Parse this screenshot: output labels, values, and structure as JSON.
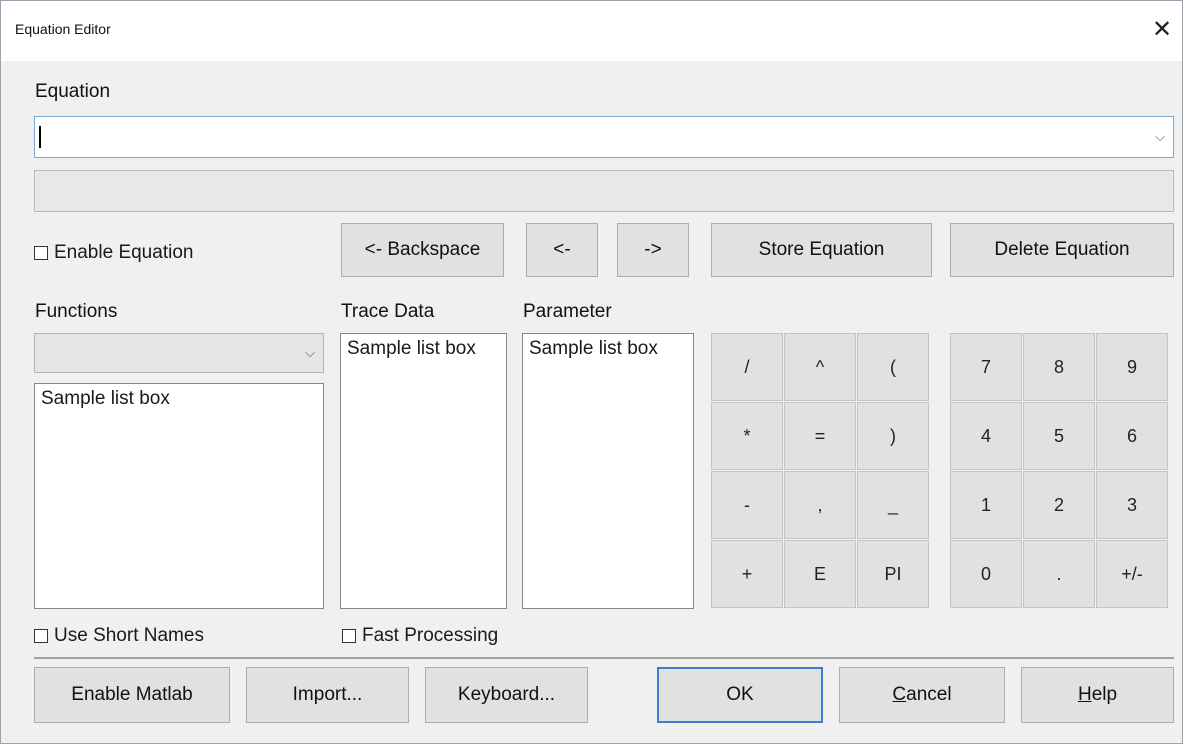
{
  "window": {
    "title": "Equation Editor",
    "close_glyph": "✕"
  },
  "equation": {
    "label": "Equation",
    "value": "",
    "dropdown_icon": "chevron-down-icon"
  },
  "controls": {
    "enable_equation": "Enable Equation",
    "backspace": "<- Backspace",
    "left": "<-",
    "right": "->",
    "store": "Store Equation",
    "delete": "Delete Equation"
  },
  "functions": {
    "label": "Functions",
    "selected": "",
    "list_item": "Sample list box"
  },
  "trace_data": {
    "label": "Trace Data",
    "list_item": "Sample list box"
  },
  "parameter": {
    "label": "Parameter",
    "list_item": "Sample list box"
  },
  "keypad_ops": [
    [
      "/",
      "^",
      "("
    ],
    [
      "*",
      "=",
      ")"
    ],
    [
      "-",
      ",",
      "_"
    ],
    [
      "+",
      "E",
      "PI"
    ]
  ],
  "keypad_nums": [
    [
      "7",
      "8",
      "9"
    ],
    [
      "4",
      "5",
      "6"
    ],
    [
      "1",
      "2",
      "3"
    ],
    [
      "0",
      ".",
      "+/-"
    ]
  ],
  "options": {
    "short_names": "Use Short Names",
    "fast_processing": "Fast Processing"
  },
  "footer": {
    "enable_matlab": "Enable Matlab",
    "import": "Import...",
    "keyboard": "Keyboard...",
    "ok": "OK",
    "cancel_prefix": "C",
    "cancel_rest": "ancel",
    "help_prefix": "H",
    "help_rest": "elp"
  }
}
